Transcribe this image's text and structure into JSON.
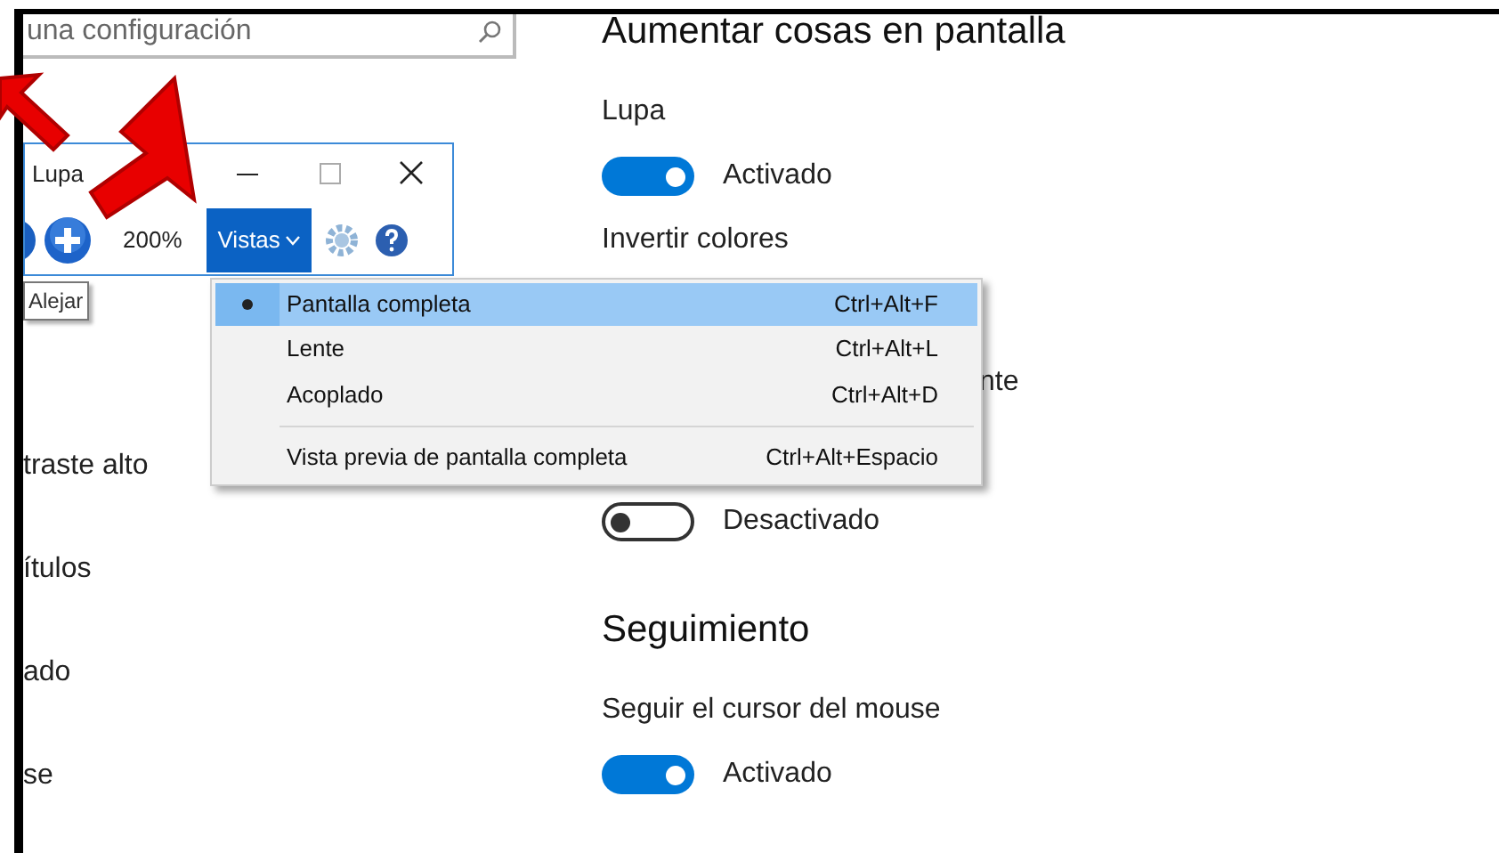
{
  "search": {
    "placeholder": "una configuración"
  },
  "sidebar": {
    "items": [
      {
        "label": "traste alto"
      },
      {
        "label": "ítulos"
      },
      {
        "label": "ado"
      },
      {
        "label": "se"
      }
    ]
  },
  "sections": [
    {
      "title": "Aumentar cosas en pantalla",
      "settings": [
        {
          "label": "Lupa",
          "toggle": {
            "on": true,
            "state": "Activado"
          }
        },
        {
          "label": "Invertir colores"
        },
        {
          "label": "nte",
          "toggle": {
            "on": false,
            "state": "Desactivado"
          }
        }
      ]
    },
    {
      "title": "Seguimiento",
      "settings": [
        {
          "label": "Seguir el cursor del mouse",
          "toggle": {
            "on": true,
            "state": "Activado"
          }
        }
      ]
    }
  ],
  "magnifier": {
    "title": "Lupa",
    "zoom": "200%",
    "views": {
      "label": "Vistas",
      "selected": true
    },
    "tooltip": "Alejar",
    "menu": [
      {
        "label": "Pantalla completa",
        "shortcut": "Ctrl+Alt+F",
        "selected": true,
        "divider_before": false
      },
      {
        "label": "Lente",
        "shortcut": "Ctrl+Alt+L",
        "selected": false,
        "divider_before": false
      },
      {
        "label": "Acoplado",
        "shortcut": "Ctrl+Alt+D",
        "selected": false,
        "divider_before": false
      },
      {
        "label": "Vista previa de pantalla completa",
        "shortcut": "Ctrl+Alt+Espacio",
        "selected": false,
        "divider_before": true
      }
    ]
  }
}
